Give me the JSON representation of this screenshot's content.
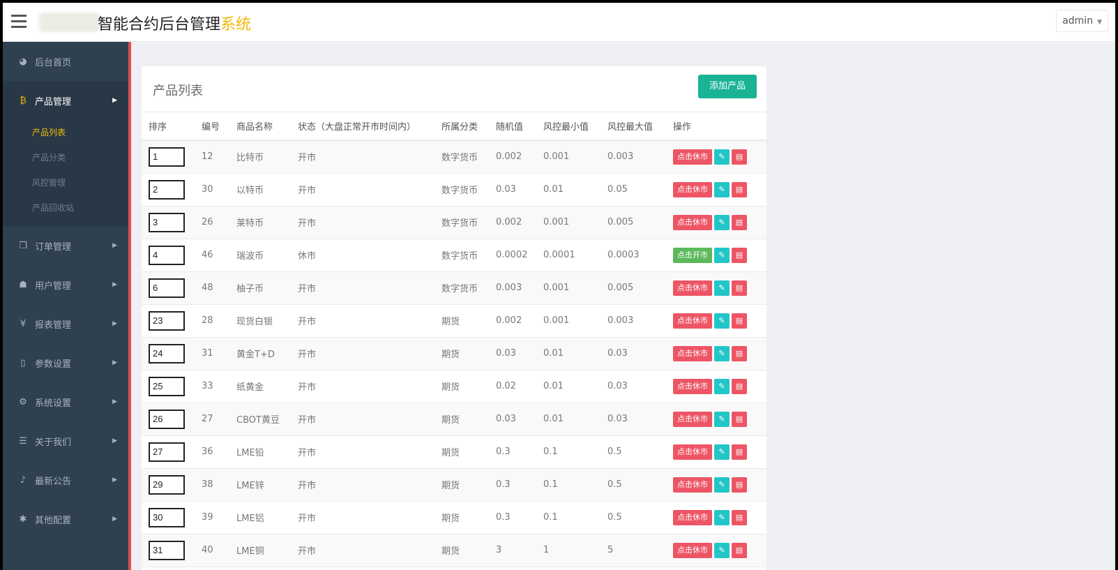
{
  "header": {
    "brand_main": "智能合约后台管理",
    "brand_accent": "系统",
    "user": "admin"
  },
  "sidebar": {
    "items": [
      {
        "icon": "dashboard-icon",
        "glyph": "◕",
        "label": "后台首页",
        "has_arrow": false
      },
      {
        "icon": "bitcoin-icon",
        "glyph": "₿",
        "label": "产品管理",
        "has_arrow": true,
        "active": true,
        "subitems": [
          {
            "label": "产品列表",
            "current": true
          },
          {
            "label": "产品分类"
          },
          {
            "label": "风控管理"
          },
          {
            "label": "产品回收站"
          }
        ]
      },
      {
        "icon": "copy-icon",
        "glyph": "❐",
        "label": "订单管理",
        "has_arrow": true
      },
      {
        "icon": "user-icon",
        "glyph": "☗",
        "label": "用户管理",
        "has_arrow": true
      },
      {
        "icon": "yen-icon",
        "glyph": "¥",
        "label": "报表管理",
        "has_arrow": true
      },
      {
        "icon": "file-icon",
        "glyph": "▯",
        "label": "参数设置",
        "has_arrow": true
      },
      {
        "icon": "gears-icon",
        "glyph": "⚙",
        "label": "系统设置",
        "has_arrow": true
      },
      {
        "icon": "list-icon",
        "glyph": "☰",
        "label": "关于我们",
        "has_arrow": true
      },
      {
        "icon": "bell-icon",
        "glyph": "♪",
        "label": "最新公告",
        "has_arrow": true
      },
      {
        "icon": "cog-icon",
        "glyph": "✱",
        "label": "其他配置",
        "has_arrow": true
      }
    ]
  },
  "panel": {
    "title": "产品列表",
    "add_button": "添加产品"
  },
  "table": {
    "columns": [
      "排序",
      "编号",
      "商品名称",
      "状态（大盘正常开市时间内）",
      "所属分类",
      "随机值",
      "风控最小值",
      "风控最大值",
      "操作"
    ],
    "rest_label": "点击休市",
    "open_label": "点击开市",
    "rows": [
      {
        "sort": "1",
        "id": "12",
        "name": "比特币",
        "status": "开市",
        "category": "数字货币",
        "random": "0.002",
        "min": "0.001",
        "max": "0.003"
      },
      {
        "sort": "2",
        "id": "30",
        "name": "以特币",
        "status": "开市",
        "category": "数字货币",
        "random": "0.03",
        "min": "0.01",
        "max": "0.05"
      },
      {
        "sort": "3",
        "id": "26",
        "name": "莱特币",
        "status": "开市",
        "category": "数字货币",
        "random": "0.002",
        "min": "0.001",
        "max": "0.005"
      },
      {
        "sort": "4",
        "id": "46",
        "name": "瑞波币",
        "status": "休市",
        "category": "数字货币",
        "random": "0.0002",
        "min": "0.0001",
        "max": "0.0003"
      },
      {
        "sort": "6",
        "id": "48",
        "name": "柚子币",
        "status": "开市",
        "category": "数字货币",
        "random": "0.003",
        "min": "0.001",
        "max": "0.005"
      },
      {
        "sort": "23",
        "id": "28",
        "name": "现货白银",
        "status": "开市",
        "category": "期货",
        "random": "0.002",
        "min": "0.001",
        "max": "0.003"
      },
      {
        "sort": "24",
        "id": "31",
        "name": "黄金T+D",
        "status": "开市",
        "category": "期货",
        "random": "0.03",
        "min": "0.01",
        "max": "0.03"
      },
      {
        "sort": "25",
        "id": "33",
        "name": "纸黄金",
        "status": "开市",
        "category": "期货",
        "random": "0.02",
        "min": "0.01",
        "max": "0.03"
      },
      {
        "sort": "26",
        "id": "27",
        "name": "CBOT黄豆",
        "status": "开市",
        "category": "期货",
        "random": "0.03",
        "min": "0.01",
        "max": "0.03"
      },
      {
        "sort": "27",
        "id": "36",
        "name": "LME铅",
        "status": "开市",
        "category": "期货",
        "random": "0.3",
        "min": "0.1",
        "max": "0.5"
      },
      {
        "sort": "29",
        "id": "38",
        "name": "LME锌",
        "status": "开市",
        "category": "期货",
        "random": "0.3",
        "min": "0.1",
        "max": "0.5"
      },
      {
        "sort": "30",
        "id": "39",
        "name": "LME铝",
        "status": "开市",
        "category": "期货",
        "random": "0.3",
        "min": "0.1",
        "max": "0.5"
      },
      {
        "sort": "31",
        "id": "40",
        "name": "LME铜",
        "status": "开市",
        "category": "期货",
        "random": "3",
        "min": "1",
        "max": "5"
      }
    ]
  }
}
